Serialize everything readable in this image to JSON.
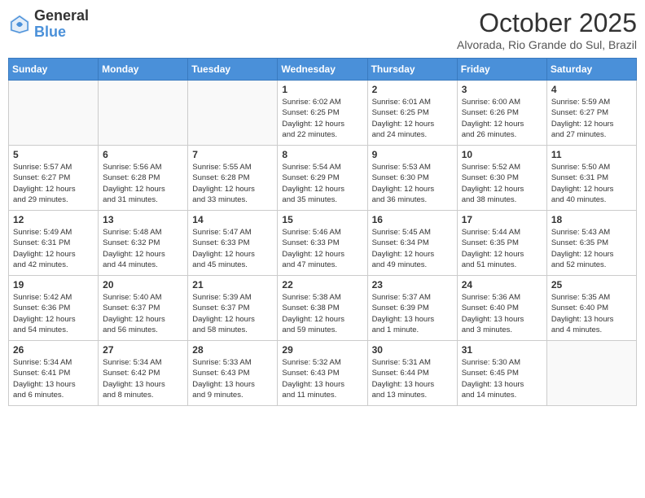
{
  "header": {
    "logo_general": "General",
    "logo_blue": "Blue",
    "month_title": "October 2025",
    "location": "Alvorada, Rio Grande do Sul, Brazil"
  },
  "calendar": {
    "days_of_week": [
      "Sunday",
      "Monday",
      "Tuesday",
      "Wednesday",
      "Thursday",
      "Friday",
      "Saturday"
    ],
    "weeks": [
      [
        {
          "day": "",
          "info": ""
        },
        {
          "day": "",
          "info": ""
        },
        {
          "day": "",
          "info": ""
        },
        {
          "day": "1",
          "info": "Sunrise: 6:02 AM\nSunset: 6:25 PM\nDaylight: 12 hours\nand 22 minutes."
        },
        {
          "day": "2",
          "info": "Sunrise: 6:01 AM\nSunset: 6:25 PM\nDaylight: 12 hours\nand 24 minutes."
        },
        {
          "day": "3",
          "info": "Sunrise: 6:00 AM\nSunset: 6:26 PM\nDaylight: 12 hours\nand 26 minutes."
        },
        {
          "day": "4",
          "info": "Sunrise: 5:59 AM\nSunset: 6:27 PM\nDaylight: 12 hours\nand 27 minutes."
        }
      ],
      [
        {
          "day": "5",
          "info": "Sunrise: 5:57 AM\nSunset: 6:27 PM\nDaylight: 12 hours\nand 29 minutes."
        },
        {
          "day": "6",
          "info": "Sunrise: 5:56 AM\nSunset: 6:28 PM\nDaylight: 12 hours\nand 31 minutes."
        },
        {
          "day": "7",
          "info": "Sunrise: 5:55 AM\nSunset: 6:28 PM\nDaylight: 12 hours\nand 33 minutes."
        },
        {
          "day": "8",
          "info": "Sunrise: 5:54 AM\nSunset: 6:29 PM\nDaylight: 12 hours\nand 35 minutes."
        },
        {
          "day": "9",
          "info": "Sunrise: 5:53 AM\nSunset: 6:30 PM\nDaylight: 12 hours\nand 36 minutes."
        },
        {
          "day": "10",
          "info": "Sunrise: 5:52 AM\nSunset: 6:30 PM\nDaylight: 12 hours\nand 38 minutes."
        },
        {
          "day": "11",
          "info": "Sunrise: 5:50 AM\nSunset: 6:31 PM\nDaylight: 12 hours\nand 40 minutes."
        }
      ],
      [
        {
          "day": "12",
          "info": "Sunrise: 5:49 AM\nSunset: 6:31 PM\nDaylight: 12 hours\nand 42 minutes."
        },
        {
          "day": "13",
          "info": "Sunrise: 5:48 AM\nSunset: 6:32 PM\nDaylight: 12 hours\nand 44 minutes."
        },
        {
          "day": "14",
          "info": "Sunrise: 5:47 AM\nSunset: 6:33 PM\nDaylight: 12 hours\nand 45 minutes."
        },
        {
          "day": "15",
          "info": "Sunrise: 5:46 AM\nSunset: 6:33 PM\nDaylight: 12 hours\nand 47 minutes."
        },
        {
          "day": "16",
          "info": "Sunrise: 5:45 AM\nSunset: 6:34 PM\nDaylight: 12 hours\nand 49 minutes."
        },
        {
          "day": "17",
          "info": "Sunrise: 5:44 AM\nSunset: 6:35 PM\nDaylight: 12 hours\nand 51 minutes."
        },
        {
          "day": "18",
          "info": "Sunrise: 5:43 AM\nSunset: 6:35 PM\nDaylight: 12 hours\nand 52 minutes."
        }
      ],
      [
        {
          "day": "19",
          "info": "Sunrise: 5:42 AM\nSunset: 6:36 PM\nDaylight: 12 hours\nand 54 minutes."
        },
        {
          "day": "20",
          "info": "Sunrise: 5:40 AM\nSunset: 6:37 PM\nDaylight: 12 hours\nand 56 minutes."
        },
        {
          "day": "21",
          "info": "Sunrise: 5:39 AM\nSunset: 6:37 PM\nDaylight: 12 hours\nand 58 minutes."
        },
        {
          "day": "22",
          "info": "Sunrise: 5:38 AM\nSunset: 6:38 PM\nDaylight: 12 hours\nand 59 minutes."
        },
        {
          "day": "23",
          "info": "Sunrise: 5:37 AM\nSunset: 6:39 PM\nDaylight: 13 hours\nand 1 minute."
        },
        {
          "day": "24",
          "info": "Sunrise: 5:36 AM\nSunset: 6:40 PM\nDaylight: 13 hours\nand 3 minutes."
        },
        {
          "day": "25",
          "info": "Sunrise: 5:35 AM\nSunset: 6:40 PM\nDaylight: 13 hours\nand 4 minutes."
        }
      ],
      [
        {
          "day": "26",
          "info": "Sunrise: 5:34 AM\nSunset: 6:41 PM\nDaylight: 13 hours\nand 6 minutes."
        },
        {
          "day": "27",
          "info": "Sunrise: 5:34 AM\nSunset: 6:42 PM\nDaylight: 13 hours\nand 8 minutes."
        },
        {
          "day": "28",
          "info": "Sunrise: 5:33 AM\nSunset: 6:43 PM\nDaylight: 13 hours\nand 9 minutes."
        },
        {
          "day": "29",
          "info": "Sunrise: 5:32 AM\nSunset: 6:43 PM\nDaylight: 13 hours\nand 11 minutes."
        },
        {
          "day": "30",
          "info": "Sunrise: 5:31 AM\nSunset: 6:44 PM\nDaylight: 13 hours\nand 13 minutes."
        },
        {
          "day": "31",
          "info": "Sunrise: 5:30 AM\nSunset: 6:45 PM\nDaylight: 13 hours\nand 14 minutes."
        },
        {
          "day": "",
          "info": ""
        }
      ]
    ]
  }
}
